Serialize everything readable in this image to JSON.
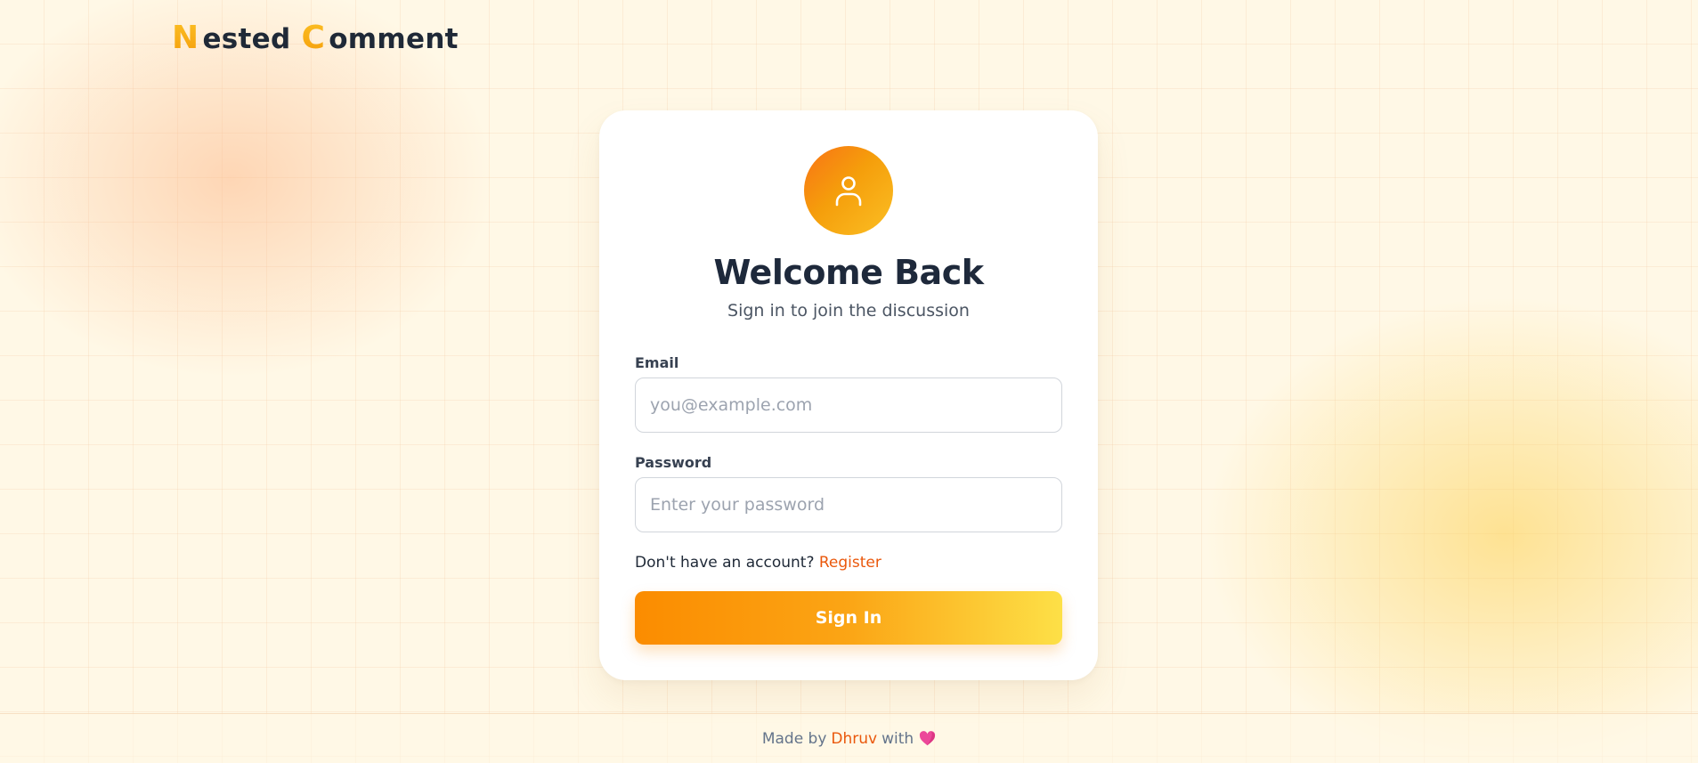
{
  "header": {
    "logo_initial_1": "N",
    "logo_rest_1": "ested",
    "logo_initial_2": "C",
    "logo_rest_2": "omment"
  },
  "login": {
    "avatar_icon": "user-icon",
    "title": "Welcome Back",
    "subtitle": "Sign in to join the discussion",
    "email_label": "Email",
    "email_placeholder": "you@example.com",
    "email_value": "",
    "password_label": "Password",
    "password_placeholder": "Enter your password",
    "password_value": "",
    "register_prompt": "Don't have an account?",
    "register_link": "Register",
    "signin_label": "Sign In"
  },
  "footer": {
    "made_by": "Made by",
    "author": "Dhruv",
    "with": "with",
    "heart_icon": "heart-icon"
  },
  "colors": {
    "accent": "#f59e0b",
    "link": "#ea580c",
    "title": "#1e293b"
  }
}
